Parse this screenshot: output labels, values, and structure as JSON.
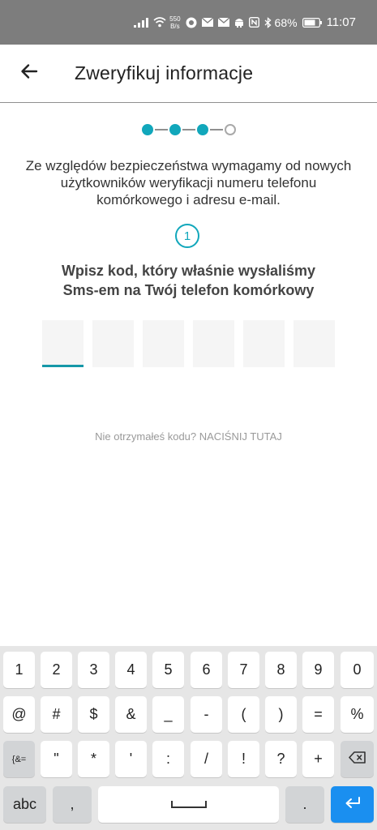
{
  "status_bar": {
    "net_speed_value": "550",
    "net_speed_unit": "B/s",
    "battery": "68%",
    "time": "11:07"
  },
  "header": {
    "title": "Zweryfikuj informacje"
  },
  "steps": {
    "total": 4,
    "completed": 3
  },
  "intro_text": "Ze względów bezpieczeństwa wymagamy od nowych użytkowników weryfikacji numeru telefonu komórkowego i adresu e-mail.",
  "step_number": "1",
  "prompt": {
    "line1": "Wpisz kod, który właśnie wysłaliśmy",
    "line2": "Sms-em na Twój telefon komórkowy"
  },
  "code": {
    "length": 6,
    "values": [
      "",
      "",
      "",
      "",
      "",
      ""
    ]
  },
  "resend_text": "Nie otrzymałeś kodu? NACIŚNIJ TUTAJ",
  "keyboard": {
    "row1": [
      "1",
      "2",
      "3",
      "4",
      "5",
      "6",
      "7",
      "8",
      "9",
      "0"
    ],
    "row2": [
      "@",
      "#",
      "$",
      "&",
      "_",
      "-",
      "(",
      ")",
      "=",
      "%"
    ],
    "row3": [
      "{&=",
      "\"",
      "*",
      "'",
      ":",
      "/",
      "!",
      "?",
      "+"
    ],
    "abc_label": "abc",
    "comma_label": ",",
    "period_label": ".",
    "accent_color": "#1a8ff0"
  },
  "colors": {
    "accent": "#11a7bb",
    "statusbar": "#7d7d7d"
  }
}
